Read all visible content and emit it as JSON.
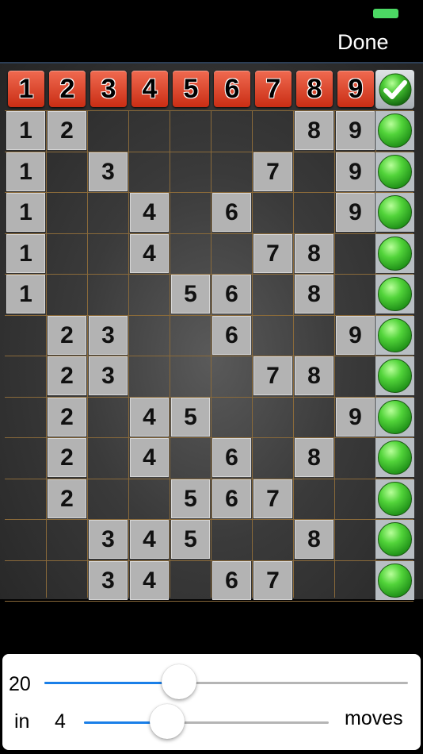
{
  "status_bar": {
    "battery_color": "#4cd964"
  },
  "nav": {
    "done_label": "Done"
  },
  "header_numbers": [
    "1",
    "2",
    "3",
    "4",
    "5",
    "6",
    "7",
    "8",
    "9"
  ],
  "header_check_icon": "checkmark-icon",
  "rows": [
    {
      "cells": [
        "1",
        "2",
        "",
        "",
        "",
        "",
        "",
        "8",
        "9"
      ],
      "status": "solved"
    },
    {
      "cells": [
        "1",
        "",
        "3",
        "",
        "",
        "",
        "7",
        "",
        "9"
      ],
      "status": "solved"
    },
    {
      "cells": [
        "1",
        "",
        "",
        "4",
        "",
        "6",
        "",
        "",
        "9"
      ],
      "status": "solved"
    },
    {
      "cells": [
        "1",
        "",
        "",
        "4",
        "",
        "",
        "7",
        "8",
        ""
      ],
      "status": "solved"
    },
    {
      "cells": [
        "1",
        "",
        "",
        "",
        "5",
        "6",
        "",
        "8",
        ""
      ],
      "status": "solved"
    },
    {
      "cells": [
        "",
        "2",
        "3",
        "",
        "",
        "6",
        "",
        "",
        "9"
      ],
      "status": "solved"
    },
    {
      "cells": [
        "",
        "2",
        "3",
        "",
        "",
        "",
        "7",
        "8",
        ""
      ],
      "status": "solved"
    },
    {
      "cells": [
        "",
        "2",
        "",
        "4",
        "5",
        "",
        "",
        "",
        "9"
      ],
      "status": "solved"
    },
    {
      "cells": [
        "",
        "2",
        "",
        "4",
        "",
        "6",
        "",
        "8",
        ""
      ],
      "status": "solved"
    },
    {
      "cells": [
        "",
        "2",
        "",
        "",
        "5",
        "6",
        "7",
        "",
        ""
      ],
      "status": "solved"
    },
    {
      "cells": [
        "",
        "",
        "3",
        "4",
        "5",
        "",
        "",
        "8",
        ""
      ],
      "status": "solved"
    },
    {
      "cells": [
        "",
        "",
        "3",
        "4",
        "",
        "6",
        "7",
        "",
        ""
      ],
      "status": "solved"
    }
  ],
  "controls": {
    "target": {
      "value": "20",
      "slider_fraction": 0.37
    },
    "moves": {
      "prefix": "in",
      "value": "4",
      "suffix": "moves",
      "slider_fraction": 0.34
    },
    "accent_color": "#1a7fe8"
  }
}
